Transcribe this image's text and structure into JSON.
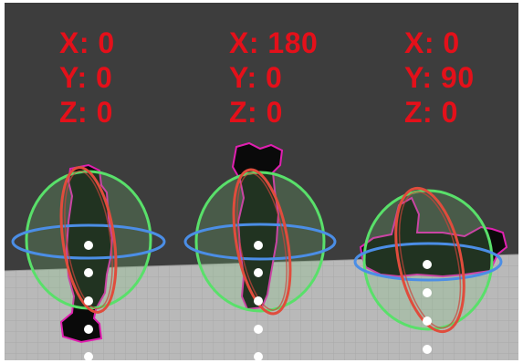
{
  "viewport": {
    "background_color": "#3d3d3d",
    "floor_color": "#b8b8b8",
    "label_color": "#e4101a"
  },
  "gizmo_colors": {
    "x_ring": "#e04c3c",
    "y_ring": "#4b8ee6",
    "z_ring": "#59e06a",
    "sphere_fill": "#7ac47a",
    "outline": "#e020b0"
  },
  "objects": [
    {
      "name": "object-1",
      "rotation": {
        "x": "X: 0",
        "y": "Y: 0",
        "z": "Z: 0"
      }
    },
    {
      "name": "object-2",
      "rotation": {
        "x": "X: 180",
        "y": "Y: 0",
        "z": "Z: 0"
      }
    },
    {
      "name": "object-3",
      "rotation": {
        "x": "X: 0",
        "y": "Y: 90",
        "z": "Z: 0"
      }
    }
  ]
}
